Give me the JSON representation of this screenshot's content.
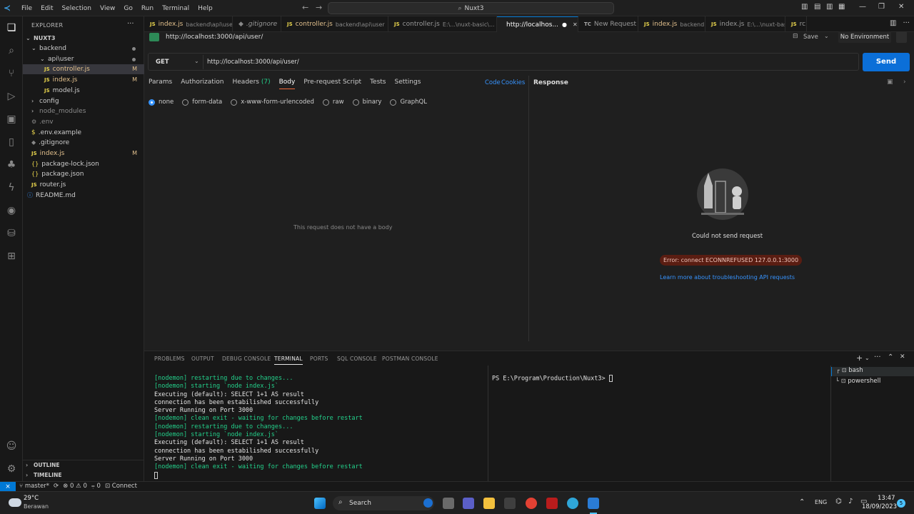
{
  "menu": [
    "File",
    "Edit",
    "Selection",
    "View",
    "Go",
    "Run",
    "Terminal",
    "Help"
  ],
  "command_center": "Nuxt3",
  "explorer": {
    "title": "EXPLORER",
    "root": "NUXT3",
    "items": [
      {
        "label": "backend",
        "type": "folder-open"
      },
      {
        "label": "api\\user",
        "type": "folder-open"
      },
      {
        "label": "controller.js",
        "type": "js",
        "marker": "M"
      },
      {
        "label": "index.js",
        "type": "js",
        "marker": "M"
      },
      {
        "label": "model.js",
        "type": "js"
      },
      {
        "label": "config",
        "type": "folder"
      },
      {
        "label": "node_modules",
        "type": "folder"
      },
      {
        "label": ".env",
        "type": "env"
      },
      {
        "label": ".env.example",
        "type": "dollar"
      },
      {
        "label": ".gitignore",
        "type": "gray"
      },
      {
        "label": "index.js",
        "type": "js",
        "marker": "M"
      },
      {
        "label": "package-lock.json",
        "type": "json"
      },
      {
        "label": "package.json",
        "type": "json"
      },
      {
        "label": "router.js",
        "type": "js"
      },
      {
        "label": "README.md",
        "type": "info"
      }
    ],
    "outline": "OUTLINE",
    "timeline": "TIMELINE"
  },
  "tabs": [
    {
      "label": "index.js",
      "sub": "backend\\api\\user",
      "marker": "M",
      "icon": "JS"
    },
    {
      "label": ".gitignore",
      "sub": "",
      "marker": "",
      "icon": "git"
    },
    {
      "label": "controller.js",
      "sub": "backend\\api\\user",
      "marker": "M",
      "icon": "JS"
    },
    {
      "label": "controller.js",
      "sub": "E:\\...\\nuxt-basic\\...",
      "marker": "",
      "icon": "JS"
    },
    {
      "label": "http://localhos...",
      "sub": "",
      "marker": "",
      "icon": "pm",
      "active": true
    },
    {
      "label": "New Request",
      "sub": "",
      "marker": "",
      "icon": "TC"
    },
    {
      "label": "index.js",
      "sub": "backend",
      "marker": "M",
      "icon": "JS"
    },
    {
      "label": "index.js",
      "sub": "E:\\...\\nuxt-basic\\backend",
      "marker": "",
      "icon": "JS"
    },
    {
      "label": "rc",
      "sub": "",
      "marker": "",
      "icon": "JS"
    }
  ],
  "request": {
    "title": "http://localhost:3000/api/user/",
    "save": "Save",
    "environment": "No Environment",
    "method": "GET",
    "url": "http://localhost:3000/api/user/",
    "send": "Send",
    "tabs": [
      "Params",
      "Authorization",
      "Headers",
      "Body",
      "Pre-request Script",
      "Tests",
      "Settings"
    ],
    "headers_count": "(7)",
    "code": "Code",
    "cookies": "Cookies",
    "body_options": [
      "none",
      "form-data",
      "x-www-form-urlencoded",
      "raw",
      "binary",
      "GraphQL"
    ],
    "no_body": "This request does not have a body"
  },
  "response": {
    "title": "Response",
    "message": "Could not send request",
    "error": "Error: connect ECONNREFUSED 127.0.0.1:3000",
    "link": "Learn more about troubleshooting API requests"
  },
  "panel": {
    "tabs": [
      "PROBLEMS",
      "OUTPUT",
      "DEBUG CONSOLE",
      "TERMINAL",
      "PORTS",
      "SQL CONSOLE",
      "POSTMAN CONSOLE"
    ],
    "terminal_lines": [
      {
        "t": "[nodemon] restarting due to changes...",
        "c": "g"
      },
      {
        "t": "[nodemon] starting `node index.js`",
        "c": "g"
      },
      {
        "t": "Executing (default): SELECT 1+1 AS result",
        "c": "w"
      },
      {
        "t": "connection has been estabilished successfully",
        "c": "w"
      },
      {
        "t": "Server Running on Port 3000",
        "c": "w"
      },
      {
        "t": "[nodemon] clean exit - waiting for changes before restart",
        "c": "g"
      },
      {
        "t": "[nodemon] restarting due to changes...",
        "c": "g"
      },
      {
        "t": "[nodemon] starting `node index.js`",
        "c": "g"
      },
      {
        "t": "Executing (default): SELECT 1+1 AS result",
        "c": "w"
      },
      {
        "t": "connection has been estabilished successfully",
        "c": "w"
      },
      {
        "t": "Server Running on Port 3000",
        "c": "w"
      },
      {
        "t": "[nodemon] clean exit - waiting for changes before restart",
        "c": "g"
      }
    ],
    "ps_prompt": "PS E:\\Program\\Production\\Nuxt3> ",
    "terminals": [
      "bash",
      "powershell"
    ]
  },
  "status": {
    "branch": "master*",
    "errors": "0",
    "warnings": "0",
    "ports": "0",
    "connect": "Connect",
    "remote_color": "#0078d4"
  },
  "taskbar": {
    "temp": "29°C",
    "weather": "Berawan",
    "search": "Search",
    "lang": "ENG",
    "time": "13:47",
    "date": "18/09/2023",
    "notif": "5"
  }
}
